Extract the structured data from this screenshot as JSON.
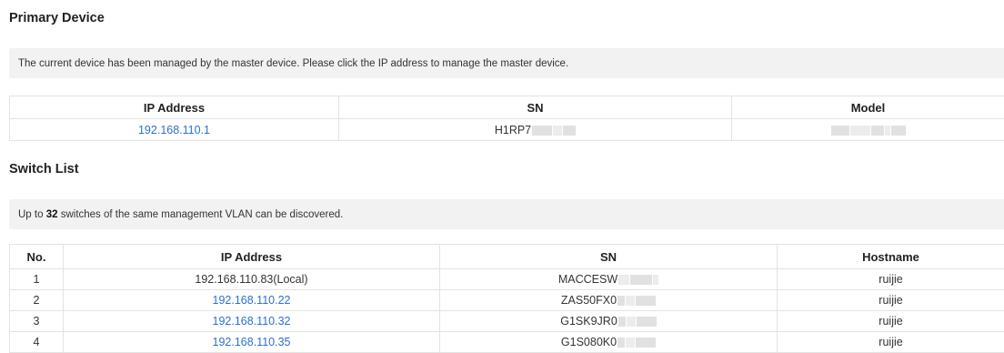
{
  "primary_device": {
    "title": "Primary Device",
    "notice": "The current device has been managed by the master device. Please click the IP address to manage the master device.",
    "columns": [
      "IP Address",
      "SN",
      "Model"
    ],
    "row": {
      "ip": "192.168.110.1",
      "sn_visible": "H1RP7چ"
    }
  },
  "switch_list": {
    "title": "Switch List",
    "notice_prefix": "Up to ",
    "notice_count": "32",
    "notice_suffix": " switches of the same management VLAN can be discovered.",
    "columns": [
      "No.",
      "IP Address",
      "SN",
      "Hostname"
    ],
    "rows": [
      {
        "no": "1",
        "ip": "192.168.110.83(Local)",
        "sn_visible": "MACCESW",
        "hostname": "ruijie",
        "ip_is_link": false
      },
      {
        "no": "2",
        "ip": "192.168.110.22",
        "sn_visible": "ZAS50FX0",
        "hostname": "ruijie",
        "ip_is_link": true
      },
      {
        "no": "3",
        "ip": "192.168.110.32",
        "sn_visible": "G1SK9JR0",
        "hostname": "ruijie",
        "ip_is_link": true
      },
      {
        "no": "4",
        "ip": "192.168.110.35",
        "sn_visible": "G1S080K0",
        "hostname": "ruijie",
        "ip_is_link": true
      }
    ]
  },
  "colors": {
    "link": "#2c6fd1",
    "notice_bg": "#f2f2f2",
    "border": "#e3e3e3",
    "mask": "#e1e1e1"
  }
}
